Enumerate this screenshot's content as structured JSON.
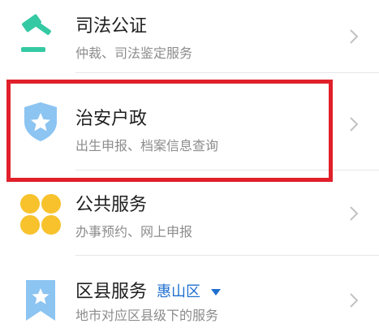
{
  "services": [
    {
      "title": "司法公证",
      "subtitle": "仲裁、司法鉴定服务",
      "icon": "gavel-icon"
    },
    {
      "title": "治安户政",
      "subtitle": "出生申报、档案信息查询",
      "icon": "shield-star-icon"
    },
    {
      "title": "公共服务",
      "subtitle": "办事预约、网上申报",
      "icon": "four-circles-icon"
    },
    {
      "title": "区县服务",
      "subtitle": "地市对应区县级下的服务",
      "icon": "bookmark-star-icon",
      "location": "惠山区"
    }
  ],
  "colors": {
    "gavel": "#34c9a3",
    "shield": "#8cc4f2",
    "circles": "#f7c22c",
    "bookmark": "#8cc4f2",
    "location": "#1f6fcf",
    "highlight": "#e0202a"
  }
}
